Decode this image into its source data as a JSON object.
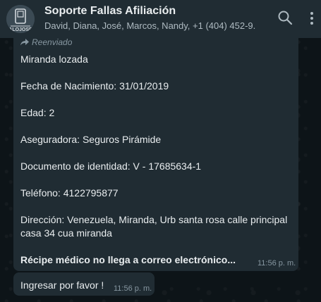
{
  "header": {
    "title": "Soporte Fallas Afiliación",
    "subtitle": "David, Diana, José, Marcos, Nandy, +1 (404) 452-9..."
  },
  "icons": {
    "avatar": "group-avatar-icon",
    "search": "search-icon",
    "menu": "more-vertical-icon",
    "forward": "forward-arrow-icon"
  },
  "messages": [
    {
      "forwarded_label": "Reenviado",
      "lines": [
        "Miranda lozada",
        "Fecha de Nacimiento: 31/01/2019",
        "Edad: 2",
        "Aseguradora: Seguros Pirámide",
        "Documento de identidad: V - 17685634-1",
        "Teléfono: 4122795877",
        "Dirección: Venezuela, Miranda, Urb santa rosa calle principal",
        "casa 34 cua miranda"
      ],
      "bold_line": "Récipe médico no llega a correo electrónico...",
      "time": "11:56 p. m."
    },
    {
      "text": "Ingresar por favor !",
      "time": "11:56 p. m."
    }
  ],
  "colors": {
    "header_bg": "#202c33",
    "chat_bg": "#0d1418",
    "bubble_bg": "#202c33",
    "text": "#e9edef",
    "meta": "#8696a0"
  }
}
